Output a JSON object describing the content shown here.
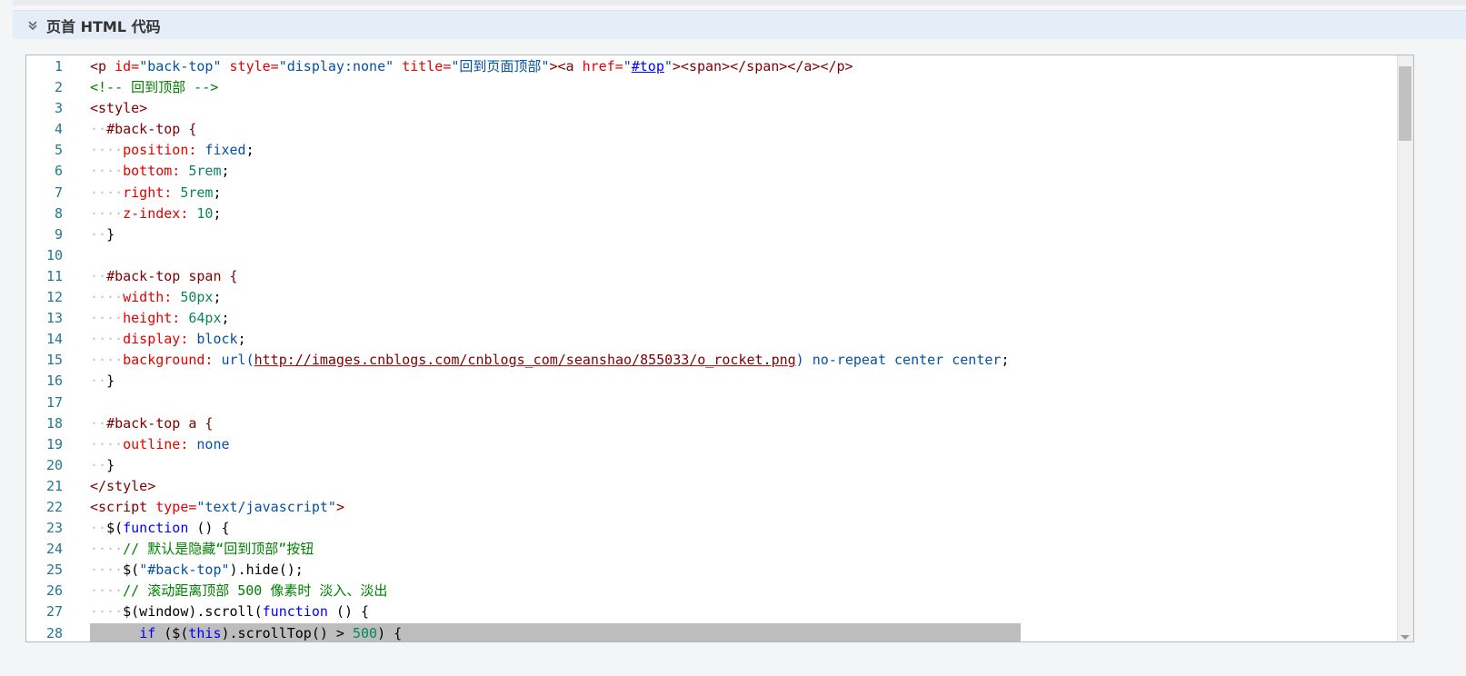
{
  "section": {
    "title": "页首 HTML 代码",
    "collapse_icon": "double-chevron-down-icon"
  },
  "editor": {
    "lines": [
      {
        "n": "1",
        "indent": "",
        "segs": [
          [
            "tag",
            "<p "
          ],
          [
            "attr",
            "id="
          ],
          [
            "str",
            "\"back-top\""
          ],
          [
            "txt",
            " "
          ],
          [
            "attr",
            "style="
          ],
          [
            "str",
            "\"display:none\""
          ],
          [
            "txt",
            " "
          ],
          [
            "attr",
            "title="
          ],
          [
            "str",
            "\"回到页面顶部\""
          ],
          [
            "tag",
            "><a "
          ],
          [
            "attr",
            "href="
          ],
          [
            "str",
            "\""
          ],
          [
            "link",
            "#top"
          ],
          [
            "str",
            "\""
          ],
          [
            "tag",
            "><span></span></a></p>"
          ]
        ]
      },
      {
        "n": "2",
        "indent": "",
        "segs": [
          [
            "cmt",
            "<!-- 回到顶部 -->"
          ]
        ]
      },
      {
        "n": "3",
        "indent": "",
        "segs": [
          [
            "tag",
            "<style>"
          ]
        ]
      },
      {
        "n": "4",
        "indent": "··",
        "segs": [
          [
            "tag",
            "#back-top {"
          ]
        ]
      },
      {
        "n": "5",
        "indent": "····",
        "segs": [
          [
            "attr",
            "position: "
          ],
          [
            "val",
            "fixed"
          ],
          [
            "txt",
            ";"
          ]
        ]
      },
      {
        "n": "6",
        "indent": "····",
        "segs": [
          [
            "attr",
            "bottom: "
          ],
          [
            "num",
            "5rem"
          ],
          [
            "txt",
            ";"
          ]
        ]
      },
      {
        "n": "7",
        "indent": "····",
        "segs": [
          [
            "attr",
            "right: "
          ],
          [
            "num",
            "5rem"
          ],
          [
            "txt",
            ";"
          ]
        ]
      },
      {
        "n": "8",
        "indent": "····",
        "segs": [
          [
            "attr",
            "z-index: "
          ],
          [
            "num",
            "10"
          ],
          [
            "txt",
            ";"
          ]
        ]
      },
      {
        "n": "9",
        "indent": "··",
        "segs": [
          [
            "txt",
            "}"
          ]
        ]
      },
      {
        "n": "10",
        "indent": "",
        "segs": []
      },
      {
        "n": "11",
        "indent": "··",
        "segs": [
          [
            "tag",
            "#back-top span {"
          ]
        ]
      },
      {
        "n": "12",
        "indent": "····",
        "segs": [
          [
            "attr",
            "width: "
          ],
          [
            "num",
            "50px"
          ],
          [
            "txt",
            ";"
          ]
        ]
      },
      {
        "n": "13",
        "indent": "····",
        "segs": [
          [
            "attr",
            "height: "
          ],
          [
            "num",
            "64px"
          ],
          [
            "txt",
            ";"
          ]
        ]
      },
      {
        "n": "14",
        "indent": "····",
        "segs": [
          [
            "attr",
            "display: "
          ],
          [
            "val",
            "block"
          ],
          [
            "txt",
            ";"
          ]
        ]
      },
      {
        "n": "15",
        "indent": "····",
        "segs": [
          [
            "attr",
            "background: "
          ],
          [
            "val",
            "url("
          ],
          [
            "url",
            "http://images.cnblogs.com/cnblogs_com/seanshao/855033/o_rocket.png"
          ],
          [
            "val",
            ") no-repeat center center"
          ],
          [
            "txt",
            ";"
          ]
        ]
      },
      {
        "n": "16",
        "indent": "··",
        "segs": [
          [
            "txt",
            "}"
          ]
        ]
      },
      {
        "n": "17",
        "indent": "",
        "segs": []
      },
      {
        "n": "18",
        "indent": "··",
        "segs": [
          [
            "tag",
            "#back-top a {"
          ]
        ]
      },
      {
        "n": "19",
        "indent": "····",
        "segs": [
          [
            "attr",
            "outline: "
          ],
          [
            "val",
            "none"
          ]
        ]
      },
      {
        "n": "20",
        "indent": "··",
        "segs": [
          [
            "txt",
            "}"
          ]
        ]
      },
      {
        "n": "21",
        "indent": "",
        "segs": [
          [
            "tag",
            "</style>"
          ]
        ]
      },
      {
        "n": "22",
        "indent": "",
        "segs": [
          [
            "tag",
            "<script "
          ],
          [
            "attr",
            "type="
          ],
          [
            "str",
            "\"text/javascript\""
          ],
          [
            "tag",
            ">"
          ]
        ]
      },
      {
        "n": "23",
        "indent": "··",
        "segs": [
          [
            "txt",
            "$("
          ],
          [
            "kw",
            "function"
          ],
          [
            "txt",
            " () {"
          ]
        ]
      },
      {
        "n": "24",
        "indent": "····",
        "segs": [
          [
            "cmt",
            "// 默认是隐藏“回到顶部”按钮"
          ]
        ]
      },
      {
        "n": "25",
        "indent": "····",
        "segs": [
          [
            "txt",
            "$("
          ],
          [
            "str",
            "\"#back-top\""
          ],
          [
            "txt",
            ").hide();"
          ]
        ]
      },
      {
        "n": "26",
        "indent": "····",
        "segs": [
          [
            "cmt",
            "// 滚动距离顶部 500 像素时 淡入、淡出"
          ]
        ]
      },
      {
        "n": "27",
        "indent": "····",
        "segs": [
          [
            "txt",
            "$(window).scroll("
          ],
          [
            "kw",
            "function"
          ],
          [
            "txt",
            " () {"
          ]
        ]
      },
      {
        "n": "28",
        "indent": "······",
        "selected": true,
        "segs": [
          [
            "kw",
            "if"
          ],
          [
            "txt",
            " ($("
          ],
          [
            "kw",
            "this"
          ],
          [
            "txt",
            ").scrollTop() > "
          ],
          [
            "num",
            "500"
          ],
          [
            "txt",
            ") {"
          ]
        ]
      }
    ]
  }
}
